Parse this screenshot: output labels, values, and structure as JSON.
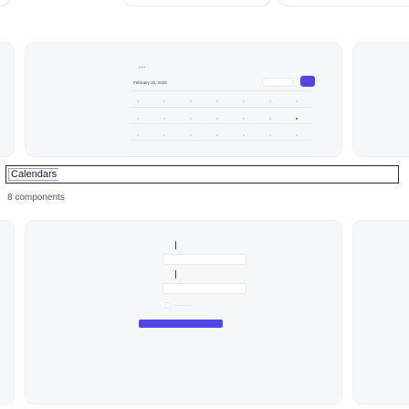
{
  "calendar_preview": {
    "menu_dots": "•••",
    "date_label": "February 22, 2022"
  },
  "section": {
    "title": "Calendars",
    "count_text": "8 components"
  },
  "colors": {
    "accent": "#4f46e5",
    "card_bg": "#f6f7f9",
    "border": "#e5e7eb"
  }
}
